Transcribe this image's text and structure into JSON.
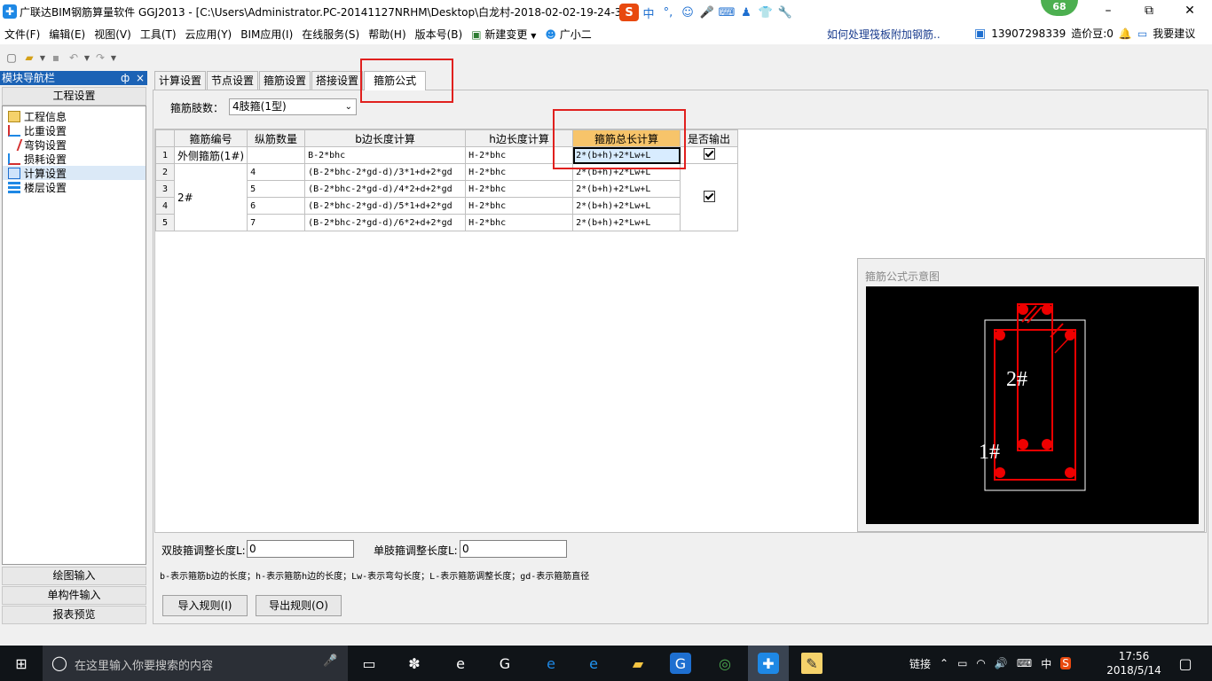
{
  "window": {
    "title": "广联达BIM钢筋算量软件 GGJ2013 - [C:\\Users\\Administrator.PC-20141127NRHM\\Desktop\\白龙村-2018-02-02-19-24-35",
    "badge": "68",
    "minimize": "–",
    "restore": "⧉",
    "close": "✕"
  },
  "ime": {
    "logo": "S",
    "lang": "中",
    "items": [
      "°,",
      "☺",
      "🎤",
      "⌨",
      "♟",
      "👕",
      "🔧"
    ]
  },
  "menu": [
    "文件(F)",
    "编辑(E)",
    "视图(V)",
    "工具(T)",
    "云应用(Y)",
    "BIM应用(I)",
    "在线服务(S)",
    "帮助(H)",
    "版本号(B)",
    "新建变更",
    "广小二"
  ],
  "help_link": "如何处理筏板附加钢筋..",
  "user": {
    "phone": "13907298339",
    "coins": "造价豆:0",
    "suggest": "我要建议"
  },
  "sidebar": {
    "title": "模块导航栏",
    "pin": "ф",
    "close": "×",
    "section_top": "工程设置",
    "items": [
      "工程信息",
      "比重设置",
      "弯钩设置",
      "损耗设置",
      "计算设置",
      "楼层设置"
    ],
    "sections_bottom": [
      "绘图输入",
      "单构件输入",
      "报表预览"
    ]
  },
  "tabs": [
    "计算设置",
    "节点设置",
    "箍筋设置",
    "搭接设置",
    "箍筋公式"
  ],
  "branches": {
    "label": "箍筋肢数：",
    "value": "4肢箍(1型)"
  },
  "grid": {
    "headers": [
      "",
      "箍筋编号",
      "纵筋数量",
      "b边长度计算",
      "h边长度计算",
      "箍筋总长计算",
      "是否输出"
    ],
    "rows": [
      {
        "n": "1",
        "id": "外侧箍筋(1#)",
        "count": "",
        "b": "B-2*bhc",
        "h": "H-2*bhc",
        "total": "2*(b+h)+2*Lw+L"
      },
      {
        "n": "2",
        "id": "",
        "count": "4",
        "b": "(B-2*bhc-2*gd-d)/3*1+d+2*gd",
        "h": "H-2*bhc",
        "total": "2*(b+h)+2*Lw+L"
      },
      {
        "n": "3",
        "id": "2#",
        "count": "5",
        "b": "(B-2*bhc-2*gd-d)/4*2+d+2*gd",
        "h": "H-2*bhc",
        "total": "2*(b+h)+2*Lw+L"
      },
      {
        "n": "4",
        "id": "",
        "count": "6",
        "b": "(B-2*bhc-2*gd-d)/5*1+d+2*gd",
        "h": "H-2*bhc",
        "total": "2*(b+h)+2*Lw+L"
      },
      {
        "n": "5",
        "id": "",
        "count": "7",
        "b": "(B-2*bhc-2*gd-d)/6*2+d+2*gd",
        "h": "H-2*bhc",
        "total": "2*(b+h)+2*Lw+L"
      }
    ]
  },
  "diagram": {
    "title": "箍筋公式示意图",
    "label_2": "2#",
    "label_1": "1#"
  },
  "bottom": {
    "double_label": "双肢箍调整长度L:",
    "double_value": "0",
    "single_label": "单肢箍调整长度L:",
    "single_value": "0",
    "legend": "b-表示箍筋b边的长度；h-表示箍筋h边的长度；Lw-表示弯勾长度；L-表示箍筋调整长度；gd-表示箍筋直径",
    "import": "导入规则(I)",
    "export": "导出规则(O)"
  },
  "taskbar": {
    "search_placeholder": "在这里输入你要搜索的内容",
    "tray_text": "链接",
    "lang": "中",
    "time": "17:56",
    "date": "2018/5/14"
  }
}
